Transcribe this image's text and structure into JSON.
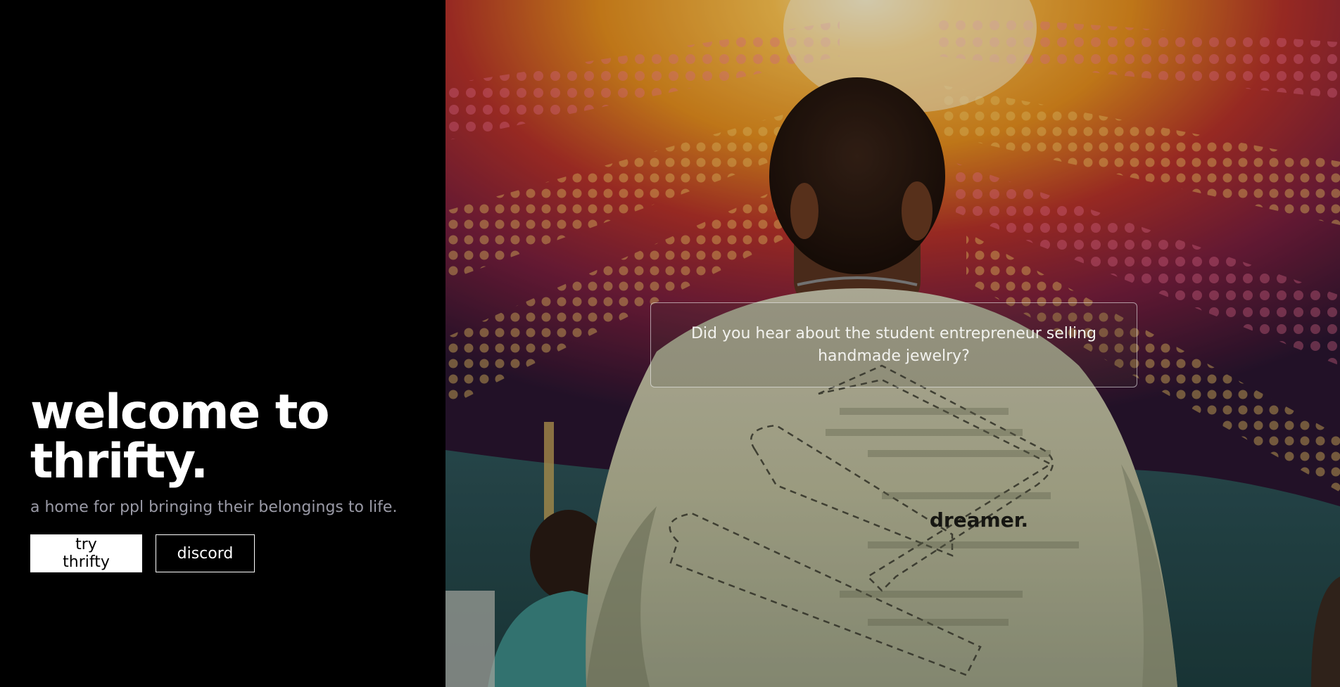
{
  "hero": {
    "title_line1": "welcome to",
    "title_line2": "thrifty.",
    "subtitle": "a home for ppl bringing their belongings to life.",
    "primary_button_label": "try thrifty",
    "secondary_button_label": "discord"
  },
  "photo": {
    "description_icon": "bokeh-photo",
    "shirt_text": "dreamer.",
    "question": "Did you hear about the student entrepreneur selling handmade jewelry?"
  },
  "colors": {
    "background": "#000000",
    "text_primary": "#ffffff",
    "text_muted": "#9a9aa6",
    "button_primary_bg": "#ffffff",
    "button_primary_text": "#000000"
  }
}
